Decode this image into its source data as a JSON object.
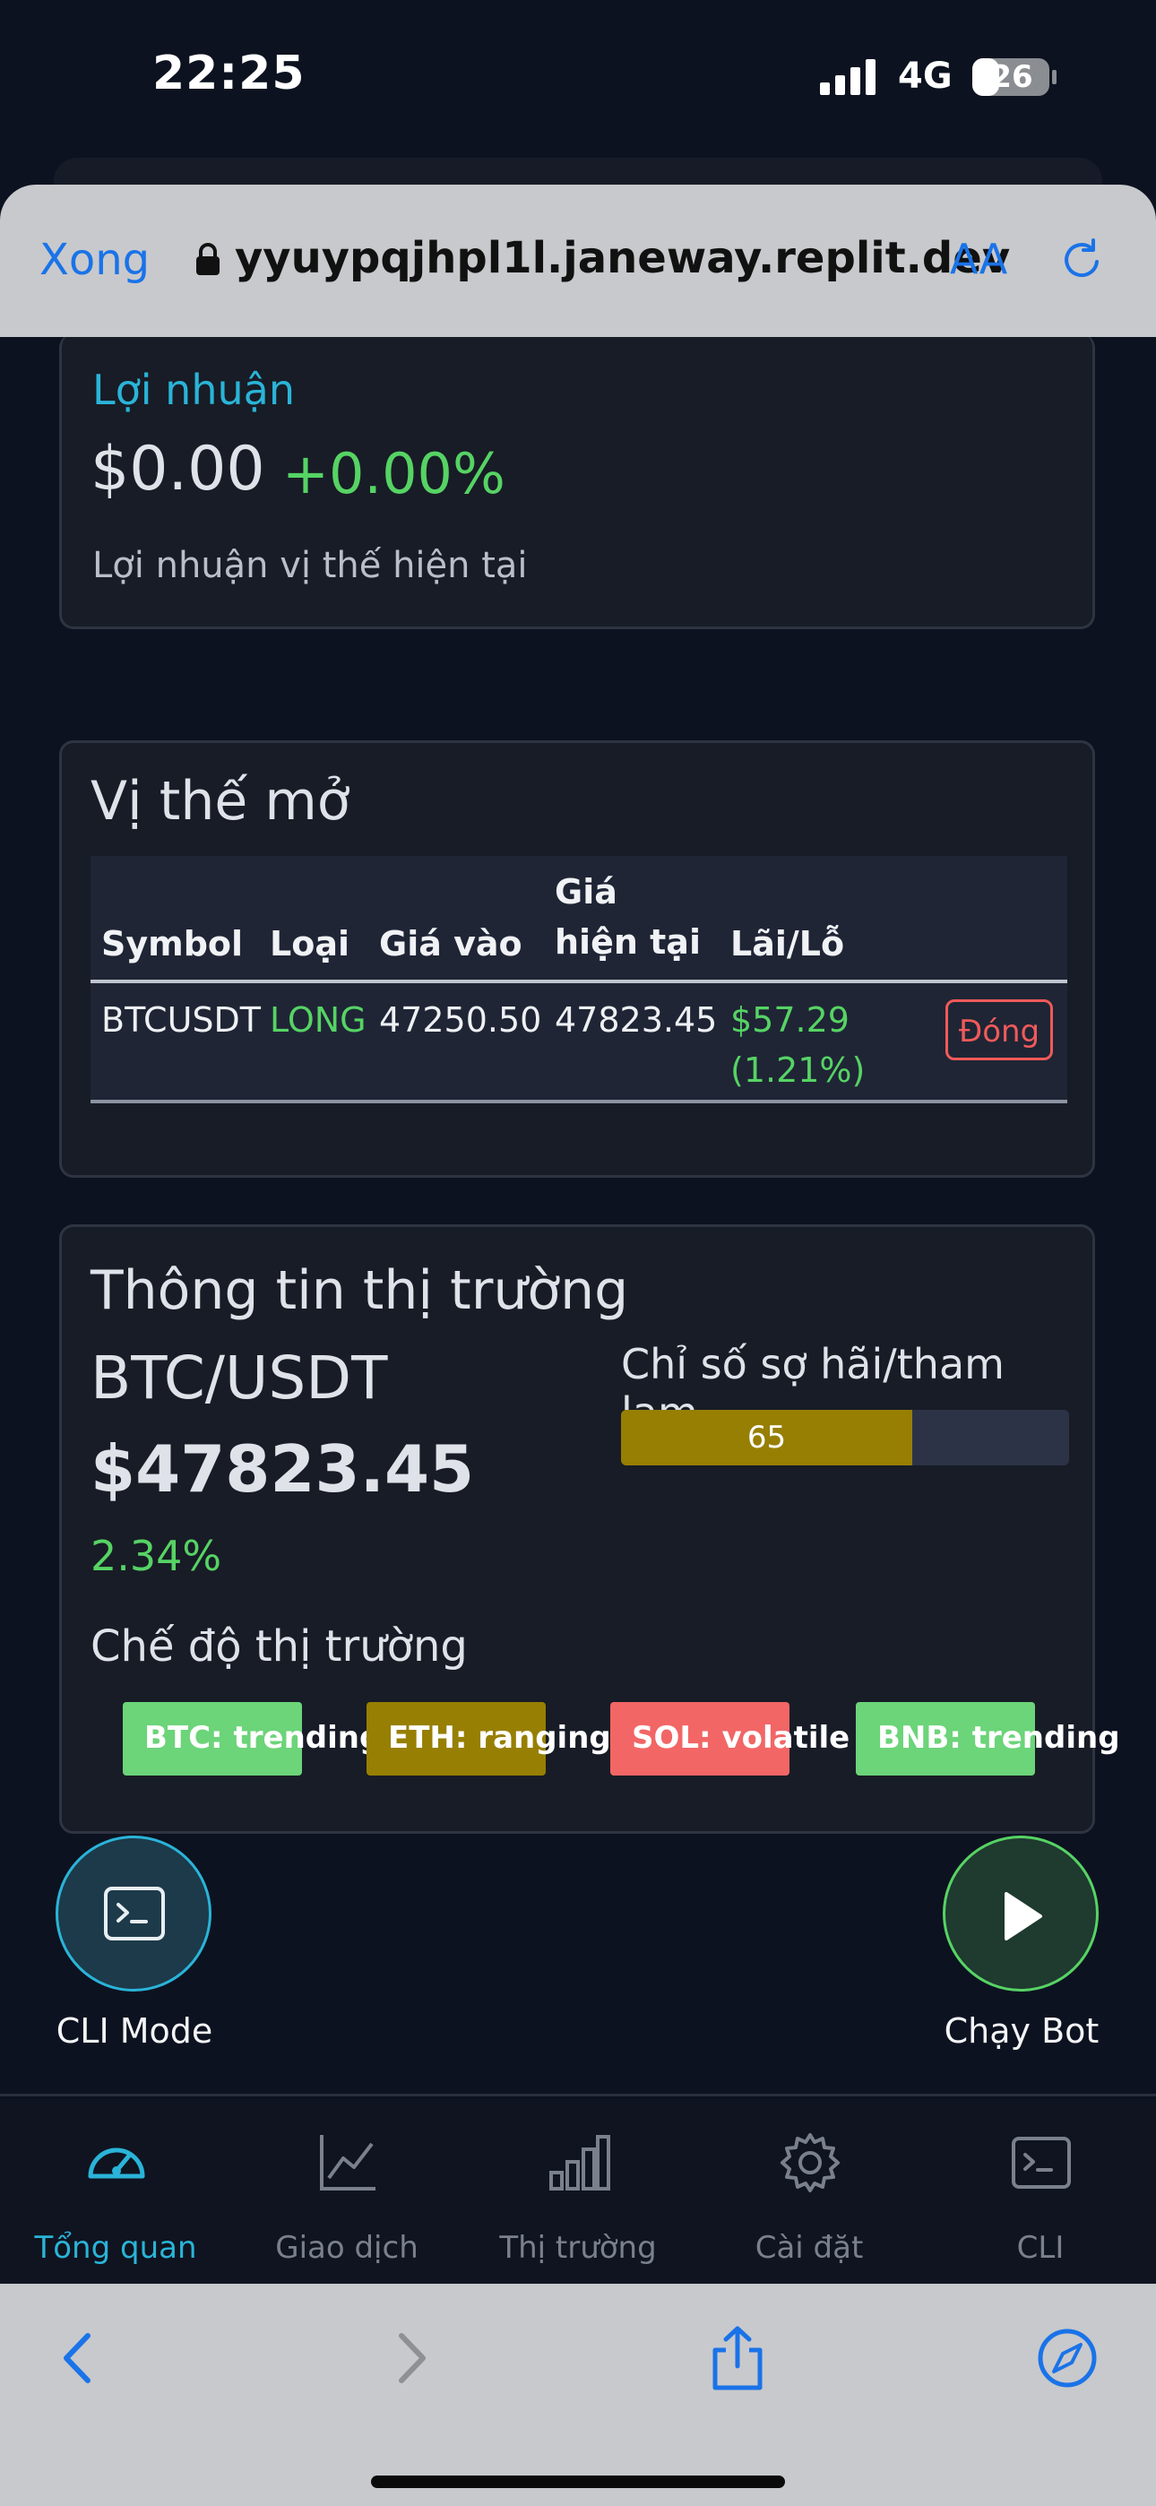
{
  "status_bar": {
    "time": "22:25",
    "network": "4G",
    "battery": "26"
  },
  "browser": {
    "done_label": "Xong",
    "url": "yyuypqjhpl1l.janeway.replit.dev",
    "text_size_label": "AA"
  },
  "profit_card": {
    "title": "Lợi nhuận",
    "value": "$0.00",
    "percent": "+0.00%",
    "description": "Lợi nhuận vị thế hiện tại"
  },
  "positions_card": {
    "title": "Vị thế mở",
    "columns": [
      "Symbol",
      "Loại",
      "Giá vào",
      "Giá hiện tại",
      "Lãi/Lỗ"
    ],
    "rows": [
      {
        "symbol": "BTCUSDT",
        "type": "LONG",
        "entry": "47250.50",
        "current": "47823.45",
        "pnl": "$57.29",
        "pnl_pct": "(1.21%)",
        "action": "Đóng"
      }
    ]
  },
  "market_card": {
    "title": "Thông tin thị trường",
    "pair": "BTC/USDT",
    "price": "$47823.45",
    "change": "2.34%",
    "fear_greed_title": "Chỉ số sợ hãi/tham lam",
    "fear_greed_value": "65",
    "fear_greed_fraction": 0.65,
    "regime_title": "Chế độ thị trường",
    "regimes": [
      {
        "label": "BTC: trending",
        "color": "#6cd479"
      },
      {
        "label": "ETH: ranging",
        "color": "#977f03"
      },
      {
        "label": "SOL: volatile",
        "color": "#f26666"
      },
      {
        "label": "BNB: trending",
        "color": "#6cd479"
      }
    ]
  },
  "fabs": {
    "cli_label": "CLI Mode",
    "run_label": "Chạy Bot"
  },
  "nav": {
    "items": [
      {
        "label": "Tổng quan",
        "icon": "speedometer-icon",
        "active": true
      },
      {
        "label": "Giao dịch",
        "icon": "line-chart-icon",
        "active": false
      },
      {
        "label": "Thị trường",
        "icon": "bar-chart-icon",
        "active": false
      },
      {
        "label": "Cài đặt",
        "icon": "gear-icon",
        "active": false
      },
      {
        "label": "CLI",
        "icon": "terminal-icon",
        "active": false
      }
    ]
  },
  "colors": {
    "accent": "#2ab4d8",
    "positive": "#56d364",
    "danger": "#f05a5a",
    "ios_blue": "#1a73e8"
  }
}
